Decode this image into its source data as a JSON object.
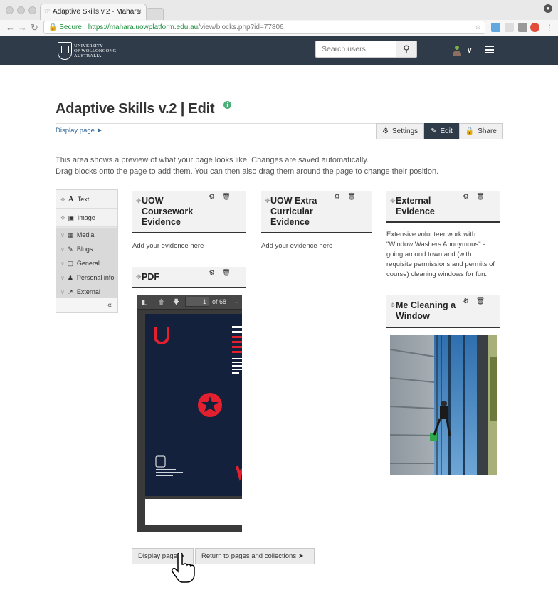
{
  "browser": {
    "tab_title": "Adaptive Skills v.2 - Mahara",
    "secure_label": "Secure",
    "url_host": "https://mahara.uowplatform.edu.au",
    "url_path": "/view/blocks.php?id=77806"
  },
  "header": {
    "logo_text": "UNIVERSITY\nOF WOLLONGONG\nAUSTRALIA",
    "search_placeholder": "Search users"
  },
  "page": {
    "title": "Adaptive Skills v.2 | Edit",
    "display_link": "Display page",
    "tabs": [
      {
        "label": "Settings",
        "active": false
      },
      {
        "label": "Edit",
        "active": true
      },
      {
        "label": "Share",
        "active": false
      }
    ],
    "intro_line1": "This area shows a preview of what your page looks like. Changes are saved automatically.",
    "intro_line2": "Drag blocks onto the page to add them. You can then also drag them around the page to change their position."
  },
  "palette": {
    "blocks": [
      {
        "label": "Text",
        "icon": "text-icon"
      },
      {
        "label": "Image",
        "icon": "image-icon"
      }
    ],
    "categories": [
      {
        "label": "Media",
        "icon": "film-icon"
      },
      {
        "label": "Blogs",
        "icon": "pencil-icon"
      },
      {
        "label": "General",
        "icon": "briefcase-icon"
      },
      {
        "label": "Personal info",
        "icon": "person-icon"
      },
      {
        "label": "External",
        "icon": "external-link-icon"
      }
    ],
    "collapse": "«"
  },
  "blocks": {
    "coursework": {
      "title": "UOW\nCoursework\nEvidence",
      "body": "Add your evidence here"
    },
    "extracurricular": {
      "title": "UOW Extra\nCurricular\nEvidence",
      "body": "Add your evidence here"
    },
    "external": {
      "title": "External\nEvidence",
      "body": "Extensive volunteer work with\n\"Window Washers Anonymous\" -\ngoing around town and (with\nrequisite permissions and permits of\ncourse) cleaning windows for fun."
    },
    "pdf": {
      "title": "PDF",
      "page_current": "1",
      "page_total": "of 68"
    },
    "photo": {
      "title": "Me Cleaning a\nWindow"
    }
  },
  "footer_buttons": {
    "display": "Display page",
    "return": "Return to pages and collections"
  },
  "colors": {
    "header_bg": "#2f3b49",
    "link": "#2a6496",
    "info": "#4caf7a",
    "pdf_navy": "#14213d",
    "pdf_red": "#e4202e"
  }
}
